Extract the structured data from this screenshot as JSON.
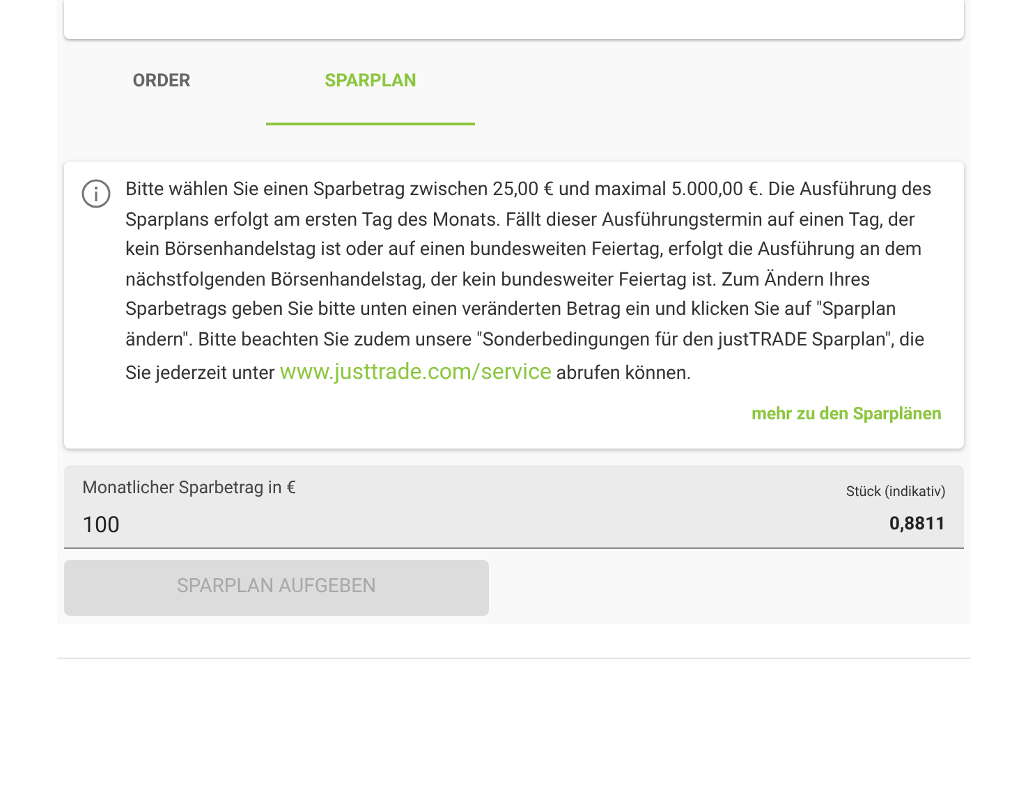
{
  "tabs": [
    {
      "label": "ORDER",
      "selected": false
    },
    {
      "label": "SPARPLAN",
      "selected": true
    }
  ],
  "info": {
    "text_before": "Bitte wählen Sie einen Sparbetrag zwischen 25,00 € und maximal 5.000,00 €. Die Ausführung des Sparplans erfolgt am ersten Tag des Monats. Fällt dieser Ausführungstermin auf einen Tag, der kein Börsenhandelstag ist oder auf einen bundesweiten Feiertag, erfolgt die Ausführung an dem nächstfolgenden Börsenhandelstag, der kein bundesweiter Feiertag ist. Zum Ändern Ihres Sparbetrags geben Sie bitte unten einen veränderten Betrag ein und klicken Sie auf \"Sparplan ändern\". Bitte beachten Sie zudem unsere \"Sonderbedingungen für den justTRADE Sparplan\", die Sie jederzeit unter",
    "link": "www.justtrade.com/service",
    "text_after": "abrufen können.",
    "more_link": "mehr zu den Sparplänen"
  },
  "amount_field": {
    "label": "Monatlicher Sparbetrag in €",
    "value": "100"
  },
  "pieces": {
    "label": "Stück (indikativ)",
    "value": "0,8811"
  },
  "submit_button": {
    "label": "SPARPLAN AUFGEBEN",
    "disabled": true
  }
}
